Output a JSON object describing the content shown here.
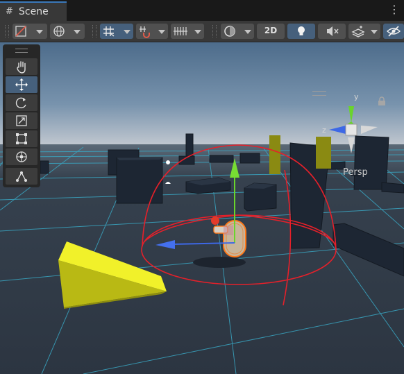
{
  "tab": {
    "label": "Scene",
    "icon": "hash-grid-icon"
  },
  "toolbar": {
    "draw_mode": "shaded-wireframe-icon",
    "global_local": "globe-icon",
    "grid_snapping": "grid-icon",
    "incremental_snap": "magnet-icon",
    "grid_visibility": "grid-lines-icon",
    "shading": "sphere-icon",
    "two_d_label": "2D",
    "lighting": "light-bulb-icon",
    "audio": "mute-icon",
    "effects": "layers-icon",
    "visibility": "eye-slash-icon"
  },
  "tools": {
    "items": [
      "hand-tool",
      "move-tool",
      "rotate-tool",
      "scale-tool",
      "rect-tool",
      "transform-tool"
    ],
    "active": "move-tool",
    "extra": "custom-editor-tool"
  },
  "gizmo": {
    "y_label": "y",
    "z_label": "z",
    "projection_label": "Persp"
  },
  "colors": {
    "sky": "#4a6a8a",
    "horizon": "#c8ccd2",
    "ground": "#2f3946",
    "grid": "#3aa9c6",
    "obstacle": "#1c2430",
    "ramp": "#e2e21a",
    "selection_red": "#e6202a",
    "x_axis": "#3d68e6",
    "y_axis": "#6ad42c",
    "active_blue": "#46607c"
  }
}
